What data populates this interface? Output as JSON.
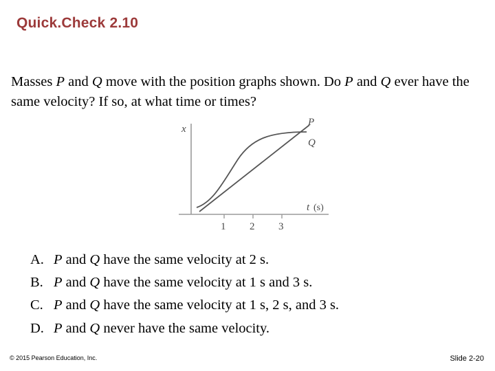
{
  "slide": {
    "title": "Quick.Check 2.10",
    "question_parts": [
      {
        "text": "Masses ",
        "italic": false
      },
      {
        "text": "P",
        "italic": true
      },
      {
        "text": " and ",
        "italic": false
      },
      {
        "text": "Q",
        "italic": true
      },
      {
        "text": " move with the position graphs shown. Do ",
        "italic": false
      },
      {
        "text": "P",
        "italic": true
      },
      {
        "text": " and ",
        "italic": false
      },
      {
        "text": "Q",
        "italic": true
      },
      {
        "text": " ever have the same velocity? If so, at what time or times?",
        "italic": false
      }
    ],
    "answers": [
      {
        "letter": "A.",
        "parts": [
          {
            "text": "P",
            "italic": true
          },
          {
            "text": " and ",
            "italic": false
          },
          {
            "text": "Q",
            "italic": true
          },
          {
            "text": " have the same velocity at 2 s.",
            "italic": false
          }
        ]
      },
      {
        "letter": "B.",
        "parts": [
          {
            "text": "P",
            "italic": true
          },
          {
            "text": " and ",
            "italic": false
          },
          {
            "text": "Q",
            "italic": true
          },
          {
            "text": " have the same velocity at 1 s and 3 s.",
            "italic": false
          }
        ]
      },
      {
        "letter": "C.",
        "parts": [
          {
            "text": "P",
            "italic": true
          },
          {
            "text": " and ",
            "italic": false
          },
          {
            "text": "Q",
            "italic": true
          },
          {
            "text": " have the same velocity at 1 s, 2 s, and 3 s.",
            "italic": false
          }
        ]
      },
      {
        "letter": "D.",
        "parts": [
          {
            "text": "P",
            "italic": true
          },
          {
            "text": " and ",
            "italic": false
          },
          {
            "text": "Q",
            "italic": true
          },
          {
            "text": " never have the same velocity.",
            "italic": false
          }
        ]
      }
    ],
    "footer_copyright": "© 2015 Pearson Education, Inc.",
    "footer_slide_number": "Slide 2-20",
    "title_color": "#9c3a3a",
    "figure": {
      "y_axis_label": "x",
      "x_axis_label": "t",
      "x_axis_unit": "(s)",
      "curve_labels": [
        "P",
        "Q"
      ],
      "x_ticks": [
        "1",
        "2",
        "3"
      ],
      "axis_color": "#8a8a8a",
      "curve_color": "#555555"
    }
  }
}
